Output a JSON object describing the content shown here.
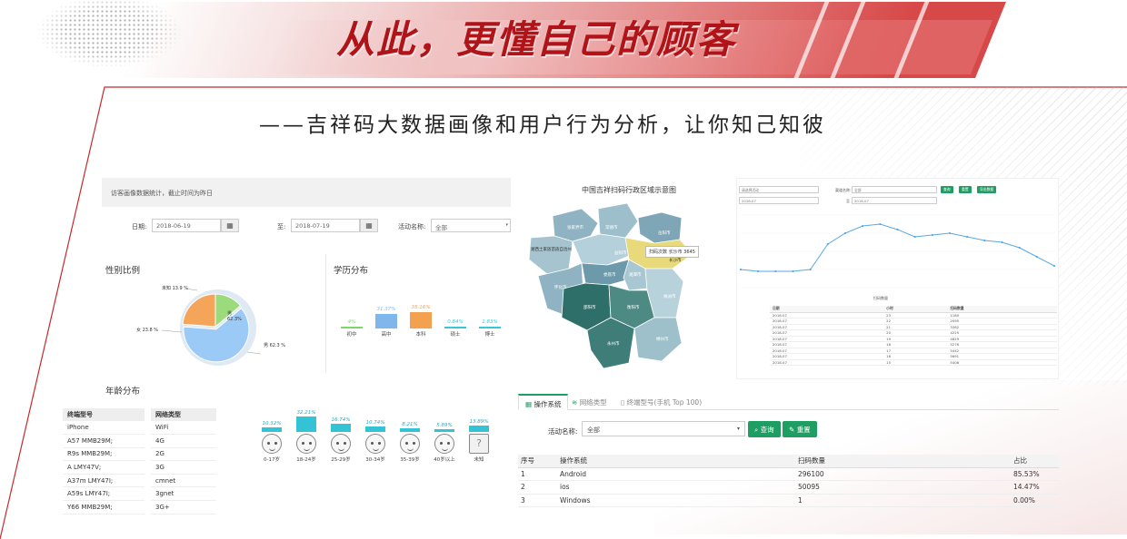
{
  "banner": {
    "headline": "从此，更懂自己的顾客"
  },
  "subtitle": "——吉祥码大数据画像和用户行为分析，让你知己知彼",
  "left_panel": {
    "notice": "访客画像数据统计，截止时间为昨日",
    "filter": {
      "date_label": "日期:",
      "date_from": "2018-06-19",
      "to_label": "至:",
      "date_to": "2018-07-19",
      "activity_label": "活动名称:",
      "activity_value": "全部"
    },
    "gender": {
      "title": "性别比例",
      "slices": [
        {
          "label": "男",
          "pct_text": "62.3%",
          "value": 62.3,
          "color": "#9ccaf7"
        },
        {
          "label": "女",
          "pct_text": "23.8%",
          "value": 23.8,
          "color": "#f5a55a"
        },
        {
          "label": "未知",
          "pct_text": "13.9%",
          "value": 13.9,
          "color": "#9bdb7c"
        }
      ],
      "outer_labels": {
        "male": "男 62.3 %",
        "female": "女 23.8 %",
        "unknown": "未知 13.9 %"
      },
      "hover_label": "男",
      "hover_pct": "62.3%"
    },
    "education": {
      "title": "学历分布",
      "items": [
        {
          "label": "初中",
          "pct": "4%",
          "value": 4,
          "color": "#7ed66b"
        },
        {
          "label": "高中",
          "pct": "31.37%",
          "value": 31.37,
          "color": "#7fb6ec"
        },
        {
          "label": "本科",
          "pct": "35.16%",
          "value": 35.16,
          "color": "#f3a14f"
        },
        {
          "label": "硕士",
          "pct": "0.84%",
          "value": 0.84,
          "color": "#37c6d8"
        },
        {
          "label": "博士",
          "pct": "1.83%",
          "value": 1.83,
          "color": "#37c6d8"
        }
      ]
    },
    "age": {
      "title": "年龄分布",
      "items": [
        {
          "label": "0-17岁",
          "pct": "10.32%",
          "value": 10.32
        },
        {
          "label": "18-24岁",
          "pct": "32.21%",
          "value": 32.21
        },
        {
          "label": "25-29岁",
          "pct": "16.74%",
          "value": 16.74
        },
        {
          "label": "30-34岁",
          "pct": "10.74%",
          "value": 10.74
        },
        {
          "label": "35-39岁",
          "pct": "8.21%",
          "value": 8.21
        },
        {
          "label": "40岁以上",
          "pct": "5.89%",
          "value": 5.89
        },
        {
          "label": "未知",
          "pct": "13.89%",
          "value": 13.89
        }
      ]
    },
    "device_table": {
      "header": "终端型号",
      "rows": [
        "iPhone",
        "A57 MMB29M;",
        "R9s MMB29M;",
        "A LMY47V;",
        "A37m LMY47I;",
        "A59s LMY47I;",
        "Y66 MMB29M;"
      ]
    },
    "network_table": {
      "header": "网络类型",
      "rows": [
        "WiFi",
        "4G",
        "2G",
        "3G",
        "cmnet",
        "3gnet",
        "3G+"
      ]
    }
  },
  "map": {
    "title": "中国吉祥扫码行政区域示意图",
    "tooltip": "扫码次数 长沙市 3645",
    "cities": [
      "张家界市",
      "常德市",
      "岳阳市",
      "湘西土家族苗族自治州",
      "益阳市",
      "长沙市",
      "怀化市",
      "娄底市",
      "湘潭市",
      "株洲市",
      "邵阳市",
      "衡阳市",
      "永州市",
      "郴州市"
    ]
  },
  "dashboard": {
    "filter": {
      "activity_value": "请选择活动",
      "channel_label": "渠道名称:",
      "channel_value": "全部",
      "date_from": "2018-07",
      "to_label": "至",
      "date_to": "2018-07",
      "btn_query": "查询",
      "btn_reset": "重置",
      "btn_export": "导出数据"
    },
    "legend": "扫码数量",
    "line_values": [
      10,
      9,
      9,
      9,
      10,
      24,
      30,
      34,
      35,
      32,
      28,
      29,
      30,
      28,
      26,
      25,
      22,
      17,
      12
    ],
    "table": {
      "headers": [
        "日期",
        "小时",
        "扫码数量"
      ],
      "rows": [
        [
          "2018-07",
          "23",
          "1180"
        ],
        [
          "2018-07",
          "22",
          "2095"
        ],
        [
          "2018-07",
          "21",
          "3362"
        ],
        [
          "2018-07",
          "20",
          "4225"
        ],
        [
          "2018-07",
          "19",
          "4829"
        ],
        [
          "2018-07",
          "18",
          "5276"
        ],
        [
          "2018-07",
          "17",
          "5442"
        ],
        [
          "2018-07",
          "16",
          "5691"
        ],
        [
          "2018-07",
          "15",
          "5408"
        ]
      ]
    }
  },
  "os_panel": {
    "tabs": [
      "操作系统",
      "网络类型",
      "终端型号(手机 Top 100)"
    ],
    "filter_label": "活动名称:",
    "filter_value": "全部",
    "btn_query": "查询",
    "btn_reset": "重置",
    "columns": [
      "序号",
      "操作系统",
      "扫码数量",
      "占比"
    ],
    "rows": [
      [
        "1",
        "Android",
        "296100",
        "85.53%"
      ],
      [
        "2",
        "ios",
        "50095",
        "14.47%"
      ],
      [
        "3",
        "Windows",
        "1",
        "0.00%"
      ]
    ]
  },
  "colors": {
    "brand_red": "#b01318",
    "green": "#1e9e63",
    "teal": "#33c3d4",
    "line_blue": "#5aa9e6"
  }
}
